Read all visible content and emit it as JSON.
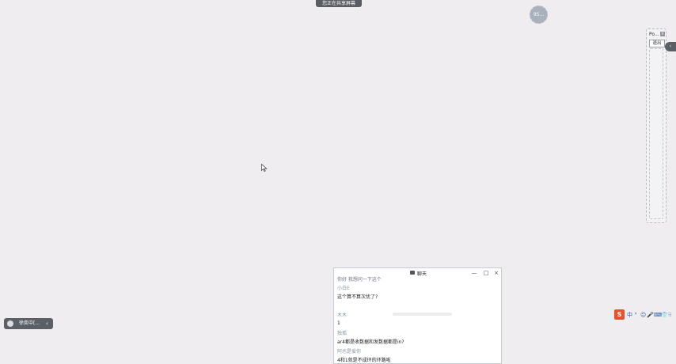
{
  "share_banner": {
    "text": "您正在共享屏幕"
  },
  "avatar": {
    "text": "95...",
    "color": "#a9b1bb"
  },
  "side_panel": {
    "title": "Po...",
    "close_symbol": "×",
    "exit_label": "退出",
    "tab_symbol": "‹"
  },
  "meeting_pill": {
    "label": "徐奕中[...",
    "chevron": "‹"
  },
  "chat": {
    "title": "聊天",
    "minimize": "—",
    "maximize": "□",
    "close": "×",
    "messages": [
      {
        "kind": "faded",
        "text": "你好 我想问一下这个"
      },
      {
        "kind": "name",
        "text": "小白E"
      },
      {
        "kind": "text",
        "text": "这个算不算次优了?"
      },
      {
        "kind": "name",
        "text": "木木"
      },
      {
        "kind": "text",
        "text": "1"
      },
      {
        "kind": "name",
        "text": "独孤"
      },
      {
        "kind": "text",
        "text": "ar4都是收数据和发数据都是in?"
      },
      {
        "kind": "name",
        "text": "阿也是爱你"
      },
      {
        "kind": "text",
        "text": "4和1就是不成环的环路啦"
      }
    ]
  },
  "ime": {
    "logo": "S",
    "items": [
      "中",
      "❜",
      "☺",
      "🎤",
      "⌨",
      "👕",
      "⁝⁝"
    ]
  },
  "colors": {
    "background": "#efedef",
    "banner": "#5a5d63",
    "ime_logo": "#e8512a",
    "ime_icons": "#2b5aa8"
  }
}
